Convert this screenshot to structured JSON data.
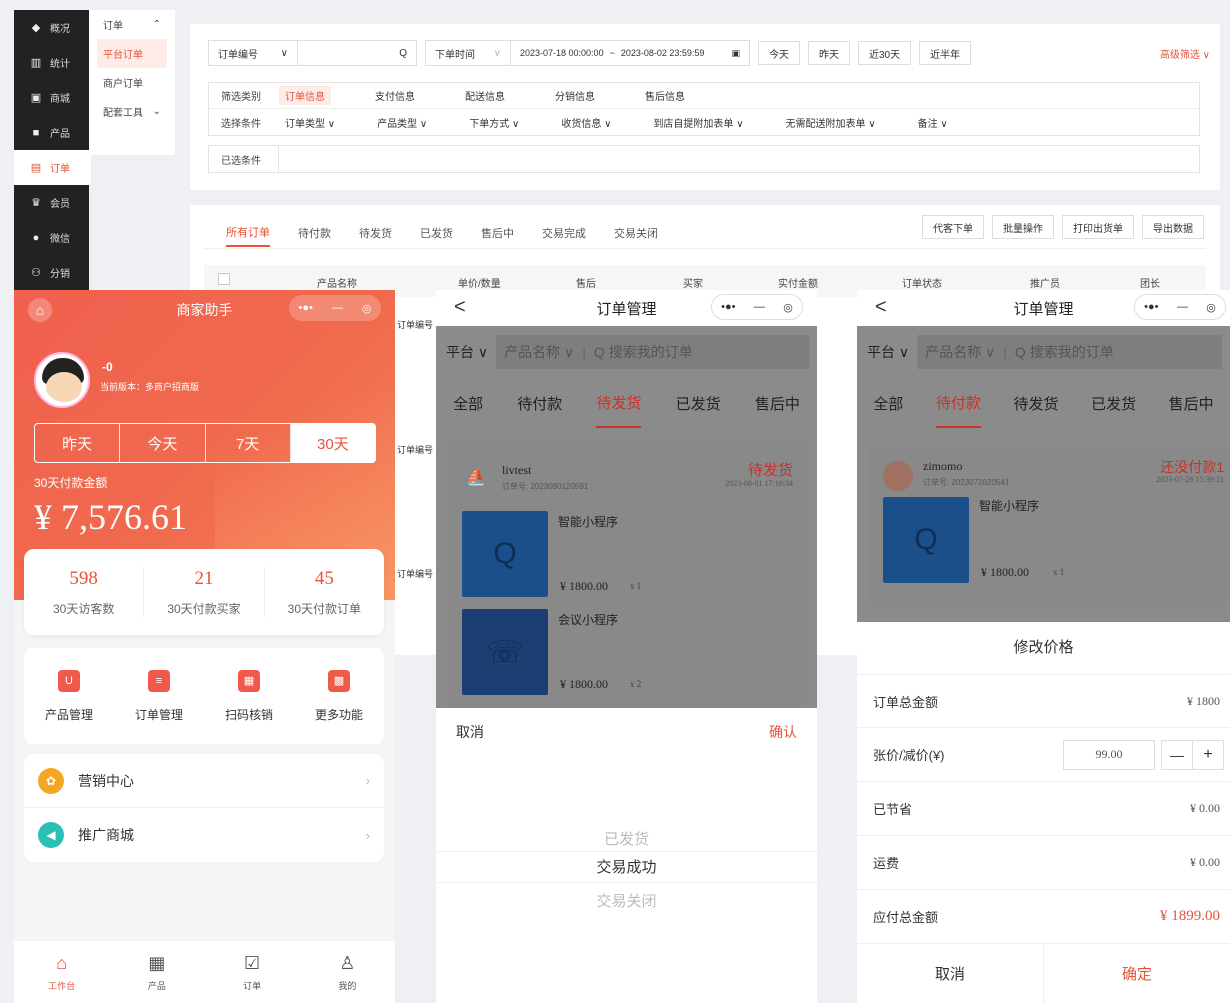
{
  "sidebar_main": [
    {
      "icon": "◆",
      "label": "概况"
    },
    {
      "icon": "▥",
      "label": "统计"
    },
    {
      "icon": "▣",
      "label": "商城"
    },
    {
      "icon": "■",
      "label": "产品"
    },
    {
      "icon": "▤",
      "label": "订单"
    },
    {
      "icon": "♛",
      "label": "会员"
    },
    {
      "icon": "●",
      "label": "微信"
    },
    {
      "icon": "⚇",
      "label": "分销"
    }
  ],
  "sidebar_sub": {
    "group": "订单",
    "items": [
      "平台订单",
      "商户订单",
      "配套工具"
    ]
  },
  "filter": {
    "field": "订单编号",
    "search_icon": "Q",
    "time_label": "下单时间",
    "start": "2023-07-18 00:00:00",
    "sep": "~",
    "end": "2023-08-02 23:59:59",
    "quick": [
      "今天",
      "昨天",
      "近30天",
      "近半年"
    ],
    "advanced": "高级筛选 ∨",
    "row1_label": "筛选类别",
    "row1": [
      "订单信息",
      "支付信息",
      "配送信息",
      "分销信息",
      "售后信息"
    ],
    "row2_label": "选择条件",
    "row2": [
      "订单类型 ∨",
      "产品类型 ∨",
      "下单方式 ∨",
      "收货信息 ∨",
      "到店自提附加表单 ∨",
      "无需配送附加表单 ∨",
      "备注 ∨"
    ],
    "selected_label": "已选条件"
  },
  "orders": {
    "tabs": [
      "所有订单",
      "待付款",
      "待发货",
      "已发货",
      "售后中",
      "交易完成",
      "交易关闭"
    ],
    "ops": [
      "代客下单",
      "批量操作",
      "打印出货单",
      "导出数据"
    ],
    "columns": [
      "产品名称",
      "单价/数量",
      "售后",
      "买家",
      "实付金额",
      "订单状态",
      "推广员",
      "团长"
    ],
    "row_label": "订单编号"
  },
  "p1": {
    "title": "商家助手",
    "capsule": [
      "•●•",
      "—",
      "◎"
    ],
    "user": "-0",
    "version": "当前版本：多商户招商版",
    "ranges": [
      "昨天",
      "今天",
      "7天",
      "30天"
    ],
    "amount_label": "30天付款金额",
    "amount": "¥ 7,576.61",
    "stats": [
      {
        "n": "598",
        "l": "30天访客数"
      },
      {
        "n": "21",
        "l": "30天付款买家"
      },
      {
        "n": "45",
        "l": "30天付款订单"
      }
    ],
    "functions": [
      {
        "icon": "U",
        "l": "产品管理"
      },
      {
        "icon": "≡",
        "l": "订单管理"
      },
      {
        "icon": "▦",
        "l": "扫码核销"
      },
      {
        "icon": "▩",
        "l": "更多功能"
      }
    ],
    "list": [
      {
        "icon": "✿",
        "l": "营销中心",
        "c": "#f5a623"
      },
      {
        "icon": "◀",
        "l": "推广商城",
        "c": "#2bc0b4"
      }
    ],
    "nav": [
      {
        "icon": "⌂",
        "l": "工作台"
      },
      {
        "icon": "▦",
        "l": "产品"
      },
      {
        "icon": "☑",
        "l": "订单"
      },
      {
        "icon": "♙",
        "l": "我的"
      }
    ]
  },
  "p2": {
    "title": "订单管理",
    "back": "<",
    "platform": "平台 ∨",
    "product": "产品名称 ∨",
    "search": "Q 搜索我的订单",
    "tabs": [
      "全部",
      "待付款",
      "待发货",
      "已发货",
      "售后中"
    ],
    "shop": "livtest",
    "order_no": "订单号: 2023080120591",
    "status": "待发货",
    "time": "2023-08-01 17:16:34",
    "items": [
      {
        "name": "智能小程序",
        "price": "¥ 1800.00",
        "qty": "x 1"
      },
      {
        "name": "会议小程序",
        "price": "¥ 1800.00",
        "qty": "x 2"
      }
    ],
    "cancel": "取消",
    "confirm": "确认",
    "picker": [
      "已发货",
      "交易成功",
      "交易关闭"
    ]
  },
  "p3": {
    "title": "订单管理",
    "back": "<",
    "platform": "平台 ∨",
    "product": "产品名称 ∨",
    "search": "Q 搜索我的订单",
    "tabs": [
      "全部",
      "待付款",
      "待发货",
      "已发货",
      "售后中"
    ],
    "shop": "zimomo",
    "order_no": "订单号: 2023072620541",
    "status": "还没付款1",
    "time": "2023-07-26 15:39:21",
    "item": {
      "name": "智能小程序",
      "price": "¥ 1800.00",
      "qty": "x 1"
    },
    "modal_title": "修改价格",
    "rows": [
      {
        "l": "订单总金额",
        "v": "¥ 1800"
      },
      {
        "l": "张价/减价(¥)",
        "v": "99.00"
      },
      {
        "l": "已节省",
        "v": "¥ 0.00"
      },
      {
        "l": "运费",
        "v": "¥ 0.00"
      },
      {
        "l": "应付总金额",
        "v": "¥ 1899.00"
      }
    ],
    "minus": "—",
    "plus": "+",
    "cancel": "取消",
    "confirm": "确定"
  },
  "colors": {
    "accent": "#e8533b",
    "dark_sidebar": "#222222"
  }
}
